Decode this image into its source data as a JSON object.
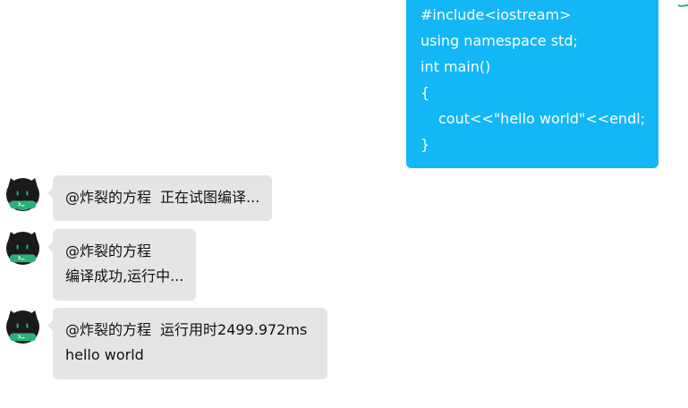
{
  "outgoing_code": {
    "lines": [
      "#include<iostream>",
      "using namespace std;",
      "int main()",
      "{",
      "cout<<\"hello world\"<<endl;",
      "}"
    ]
  },
  "messages": [
    {
      "mention": "@炸裂的方程",
      "status": "正在试图编译..."
    },
    {
      "mention": "@炸裂的方程",
      "status": "编译成功,运行中..."
    },
    {
      "mention": "@炸裂的方程",
      "status": "运行用时2499.972ms",
      "output": "hello world"
    }
  ],
  "colors": {
    "outgoing_bubble": "#13b7f6",
    "incoming_bubble": "#e5e5e5",
    "avatar_face": "#1a1a1a",
    "avatar_accent": "#2bb07a"
  },
  "icons": {
    "avatar": "black-cat-terminal-avatar"
  }
}
